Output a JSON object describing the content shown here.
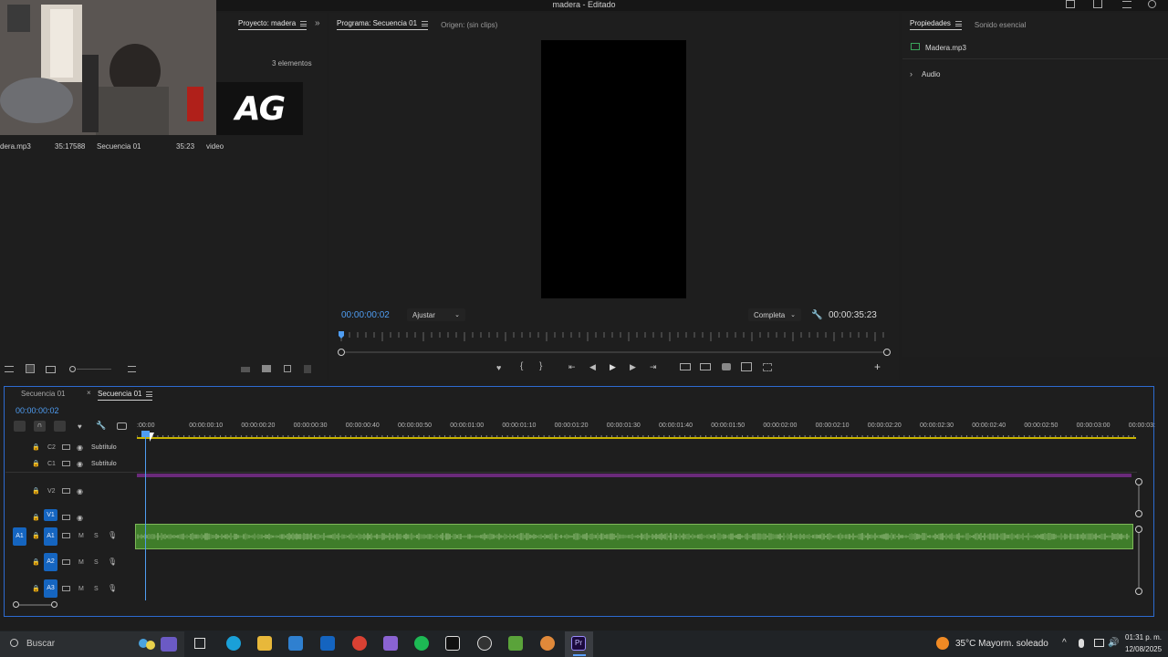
{
  "window": {
    "title": "madera - Editado"
  },
  "project_panel": {
    "tab_label": "Proyecto: madera",
    "item_count": "3 elementos",
    "items": [
      {
        "name": "dera.mp3",
        "duration": "35:17588"
      },
      {
        "name": "Secuencia 01",
        "duration": "35:23"
      },
      {
        "name": "video",
        "duration": ""
      }
    ],
    "thumb_logo_text": "AG"
  },
  "program_monitor": {
    "tab_label": "Programa: Secuencia 01",
    "source_tab_label": "Origen: (sin clips)",
    "current_time": "00:00:00:02",
    "fit_select": "Ajustar",
    "quality_select": "Completa",
    "duration": "00:00:35:23"
  },
  "properties_panel": {
    "tab_label": "Propiedades",
    "tab2_label": "Sonido esencial",
    "file_name": "Madera.mp3",
    "section_label": "Audio"
  },
  "timeline": {
    "tabs": [
      "Secuencia 01",
      "Secuencia 01"
    ],
    "current_time": "00:00:00:02",
    "ruler_labels": [
      ":00:00",
      "00:00:00:10",
      "00:00:00:20",
      "00:00:00:30",
      "00:00:00:40",
      "00:00:00:50",
      "00:00:01:00",
      "00:00:01:10",
      "00:00:01:20",
      "00:00:01:30",
      "00:00:01:40",
      "00:00:01:50",
      "00:00:02:00",
      "00:00:02:10",
      "00:00:02:20",
      "00:00:02:30",
      "00:00:02:40",
      "00:00:02:50",
      "00:00:03:00",
      "00:00:03:"
    ],
    "caption_tracks": [
      {
        "id": "C2",
        "label": "Subtítulo"
      },
      {
        "id": "C1",
        "label": "Subtítulo"
      }
    ],
    "video_tracks": [
      "V2",
      "V1"
    ],
    "audio_tracks": [
      "A1",
      "A2",
      "A3"
    ],
    "source_patch": "A1",
    "mute_label": "M",
    "solo_label": "S",
    "colors": {
      "audio_clip": "#3f7d2a",
      "caption_bar": "#6a2a7a",
      "accent": "#4f9df2"
    }
  },
  "taskbar": {
    "search_placeholder": "Buscar",
    "weather": "35°C  Mayorm. soleado",
    "time": "01:31 p. m.",
    "date": "12/08/2025"
  }
}
